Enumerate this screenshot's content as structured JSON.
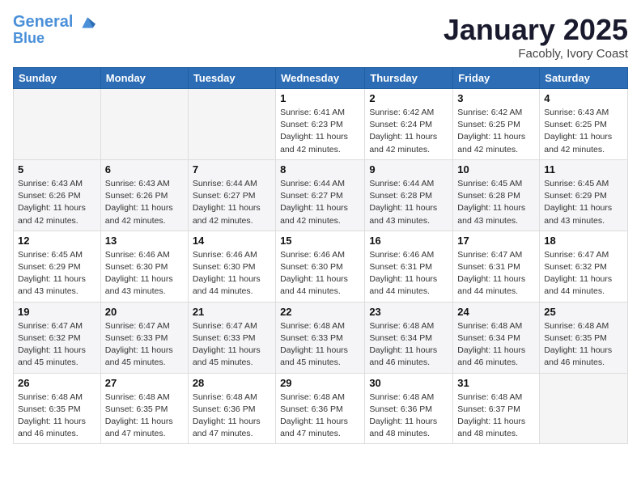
{
  "header": {
    "logo_line1": "General",
    "logo_line2": "Blue",
    "month": "January 2025",
    "location": "Facobly, Ivory Coast"
  },
  "weekdays": [
    "Sunday",
    "Monday",
    "Tuesday",
    "Wednesday",
    "Thursday",
    "Friday",
    "Saturday"
  ],
  "weeks": [
    [
      {
        "day": "",
        "info": ""
      },
      {
        "day": "",
        "info": ""
      },
      {
        "day": "",
        "info": ""
      },
      {
        "day": "1",
        "info": "Sunrise: 6:41 AM\nSunset: 6:23 PM\nDaylight: 11 hours\nand 42 minutes."
      },
      {
        "day": "2",
        "info": "Sunrise: 6:42 AM\nSunset: 6:24 PM\nDaylight: 11 hours\nand 42 minutes."
      },
      {
        "day": "3",
        "info": "Sunrise: 6:42 AM\nSunset: 6:25 PM\nDaylight: 11 hours\nand 42 minutes."
      },
      {
        "day": "4",
        "info": "Sunrise: 6:43 AM\nSunset: 6:25 PM\nDaylight: 11 hours\nand 42 minutes."
      }
    ],
    [
      {
        "day": "5",
        "info": "Sunrise: 6:43 AM\nSunset: 6:26 PM\nDaylight: 11 hours\nand 42 minutes."
      },
      {
        "day": "6",
        "info": "Sunrise: 6:43 AM\nSunset: 6:26 PM\nDaylight: 11 hours\nand 42 minutes."
      },
      {
        "day": "7",
        "info": "Sunrise: 6:44 AM\nSunset: 6:27 PM\nDaylight: 11 hours\nand 42 minutes."
      },
      {
        "day": "8",
        "info": "Sunrise: 6:44 AM\nSunset: 6:27 PM\nDaylight: 11 hours\nand 42 minutes."
      },
      {
        "day": "9",
        "info": "Sunrise: 6:44 AM\nSunset: 6:28 PM\nDaylight: 11 hours\nand 43 minutes."
      },
      {
        "day": "10",
        "info": "Sunrise: 6:45 AM\nSunset: 6:28 PM\nDaylight: 11 hours\nand 43 minutes."
      },
      {
        "day": "11",
        "info": "Sunrise: 6:45 AM\nSunset: 6:29 PM\nDaylight: 11 hours\nand 43 minutes."
      }
    ],
    [
      {
        "day": "12",
        "info": "Sunrise: 6:45 AM\nSunset: 6:29 PM\nDaylight: 11 hours\nand 43 minutes."
      },
      {
        "day": "13",
        "info": "Sunrise: 6:46 AM\nSunset: 6:30 PM\nDaylight: 11 hours\nand 43 minutes."
      },
      {
        "day": "14",
        "info": "Sunrise: 6:46 AM\nSunset: 6:30 PM\nDaylight: 11 hours\nand 44 minutes."
      },
      {
        "day": "15",
        "info": "Sunrise: 6:46 AM\nSunset: 6:30 PM\nDaylight: 11 hours\nand 44 minutes."
      },
      {
        "day": "16",
        "info": "Sunrise: 6:46 AM\nSunset: 6:31 PM\nDaylight: 11 hours\nand 44 minutes."
      },
      {
        "day": "17",
        "info": "Sunrise: 6:47 AM\nSunset: 6:31 PM\nDaylight: 11 hours\nand 44 minutes."
      },
      {
        "day": "18",
        "info": "Sunrise: 6:47 AM\nSunset: 6:32 PM\nDaylight: 11 hours\nand 44 minutes."
      }
    ],
    [
      {
        "day": "19",
        "info": "Sunrise: 6:47 AM\nSunset: 6:32 PM\nDaylight: 11 hours\nand 45 minutes."
      },
      {
        "day": "20",
        "info": "Sunrise: 6:47 AM\nSunset: 6:33 PM\nDaylight: 11 hours\nand 45 minutes."
      },
      {
        "day": "21",
        "info": "Sunrise: 6:47 AM\nSunset: 6:33 PM\nDaylight: 11 hours\nand 45 minutes."
      },
      {
        "day": "22",
        "info": "Sunrise: 6:48 AM\nSunset: 6:33 PM\nDaylight: 11 hours\nand 45 minutes."
      },
      {
        "day": "23",
        "info": "Sunrise: 6:48 AM\nSunset: 6:34 PM\nDaylight: 11 hours\nand 46 minutes."
      },
      {
        "day": "24",
        "info": "Sunrise: 6:48 AM\nSunset: 6:34 PM\nDaylight: 11 hours\nand 46 minutes."
      },
      {
        "day": "25",
        "info": "Sunrise: 6:48 AM\nSunset: 6:35 PM\nDaylight: 11 hours\nand 46 minutes."
      }
    ],
    [
      {
        "day": "26",
        "info": "Sunrise: 6:48 AM\nSunset: 6:35 PM\nDaylight: 11 hours\nand 46 minutes."
      },
      {
        "day": "27",
        "info": "Sunrise: 6:48 AM\nSunset: 6:35 PM\nDaylight: 11 hours\nand 47 minutes."
      },
      {
        "day": "28",
        "info": "Sunrise: 6:48 AM\nSunset: 6:36 PM\nDaylight: 11 hours\nand 47 minutes."
      },
      {
        "day": "29",
        "info": "Sunrise: 6:48 AM\nSunset: 6:36 PM\nDaylight: 11 hours\nand 47 minutes."
      },
      {
        "day": "30",
        "info": "Sunrise: 6:48 AM\nSunset: 6:36 PM\nDaylight: 11 hours\nand 48 minutes."
      },
      {
        "day": "31",
        "info": "Sunrise: 6:48 AM\nSunset: 6:37 PM\nDaylight: 11 hours\nand 48 minutes."
      },
      {
        "day": "",
        "info": ""
      }
    ]
  ]
}
